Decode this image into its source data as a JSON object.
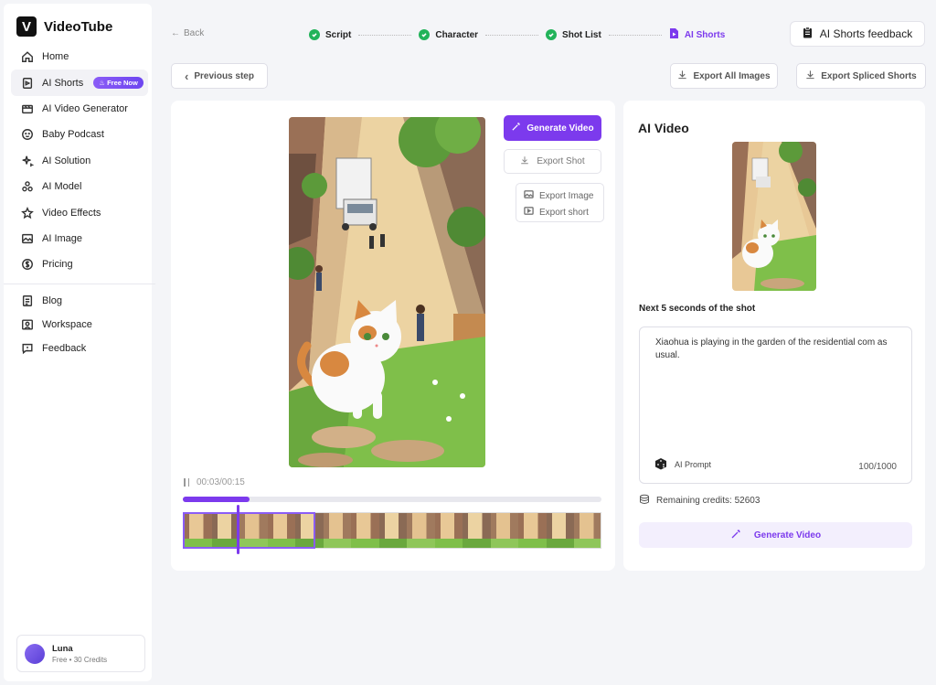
{
  "app": {
    "logo_letter": "V",
    "name": "VideoTube"
  },
  "sidebar": {
    "items": [
      {
        "label": "Home",
        "icon": "home-icon"
      },
      {
        "label": "AI Shorts",
        "icon": "shorts-icon",
        "badge": "Free Now",
        "active": true
      },
      {
        "label": "AI Video Generator",
        "icon": "video-generator-icon"
      },
      {
        "label": "Baby Podcast",
        "icon": "baby-face-icon"
      },
      {
        "label": "AI Solution",
        "icon": "sparkle-icon"
      },
      {
        "label": "AI Model",
        "icon": "model-icon"
      },
      {
        "label": "Video Effects",
        "icon": "effects-icon"
      },
      {
        "label": "AI Image",
        "icon": "image-icon"
      },
      {
        "label": "Pricing",
        "icon": "dollar-icon"
      }
    ],
    "secondary": [
      {
        "label": "Blog",
        "icon": "blog-icon"
      },
      {
        "label": "Workspace",
        "icon": "workspace-icon"
      },
      {
        "label": "Feedback",
        "icon": "feedback-icon"
      }
    ],
    "user": {
      "name": "Luna",
      "plan": "Free",
      "credits": "30 Credits"
    }
  },
  "topbar": {
    "back_label": "Back",
    "steps": [
      {
        "label": "Script",
        "done": true
      },
      {
        "label": "Character",
        "done": true
      },
      {
        "label": "Shot List",
        "done": true
      },
      {
        "label": "AI Shorts",
        "current": true
      }
    ],
    "feedback_label": "AI Shorts feedback"
  },
  "toolbar": {
    "previous_label": "Previous step",
    "export_all_label": "Export All Images",
    "export_spliced_label": "Export Spliced Shorts"
  },
  "editor": {
    "generate_label": "Generate Video",
    "export_shot_label": "Export Shot",
    "export_image_label": "Export Image",
    "export_short_label": "Export short",
    "time": "00:03/00:15",
    "progress": 0.16
  },
  "ai_video": {
    "title": "AI Video",
    "next_label": "Next 5 seconds of the shot",
    "prompt_text": "Xiaohua is playing in the garden of the residential com as usual.",
    "prompt_label": "AI Prompt",
    "prompt_count": "100/1000",
    "credits_label": "Remaining credits: 52603",
    "generate_label": "Generate Video"
  },
  "colors": {
    "accent": "#7c3aed",
    "success": "#22b35a"
  }
}
